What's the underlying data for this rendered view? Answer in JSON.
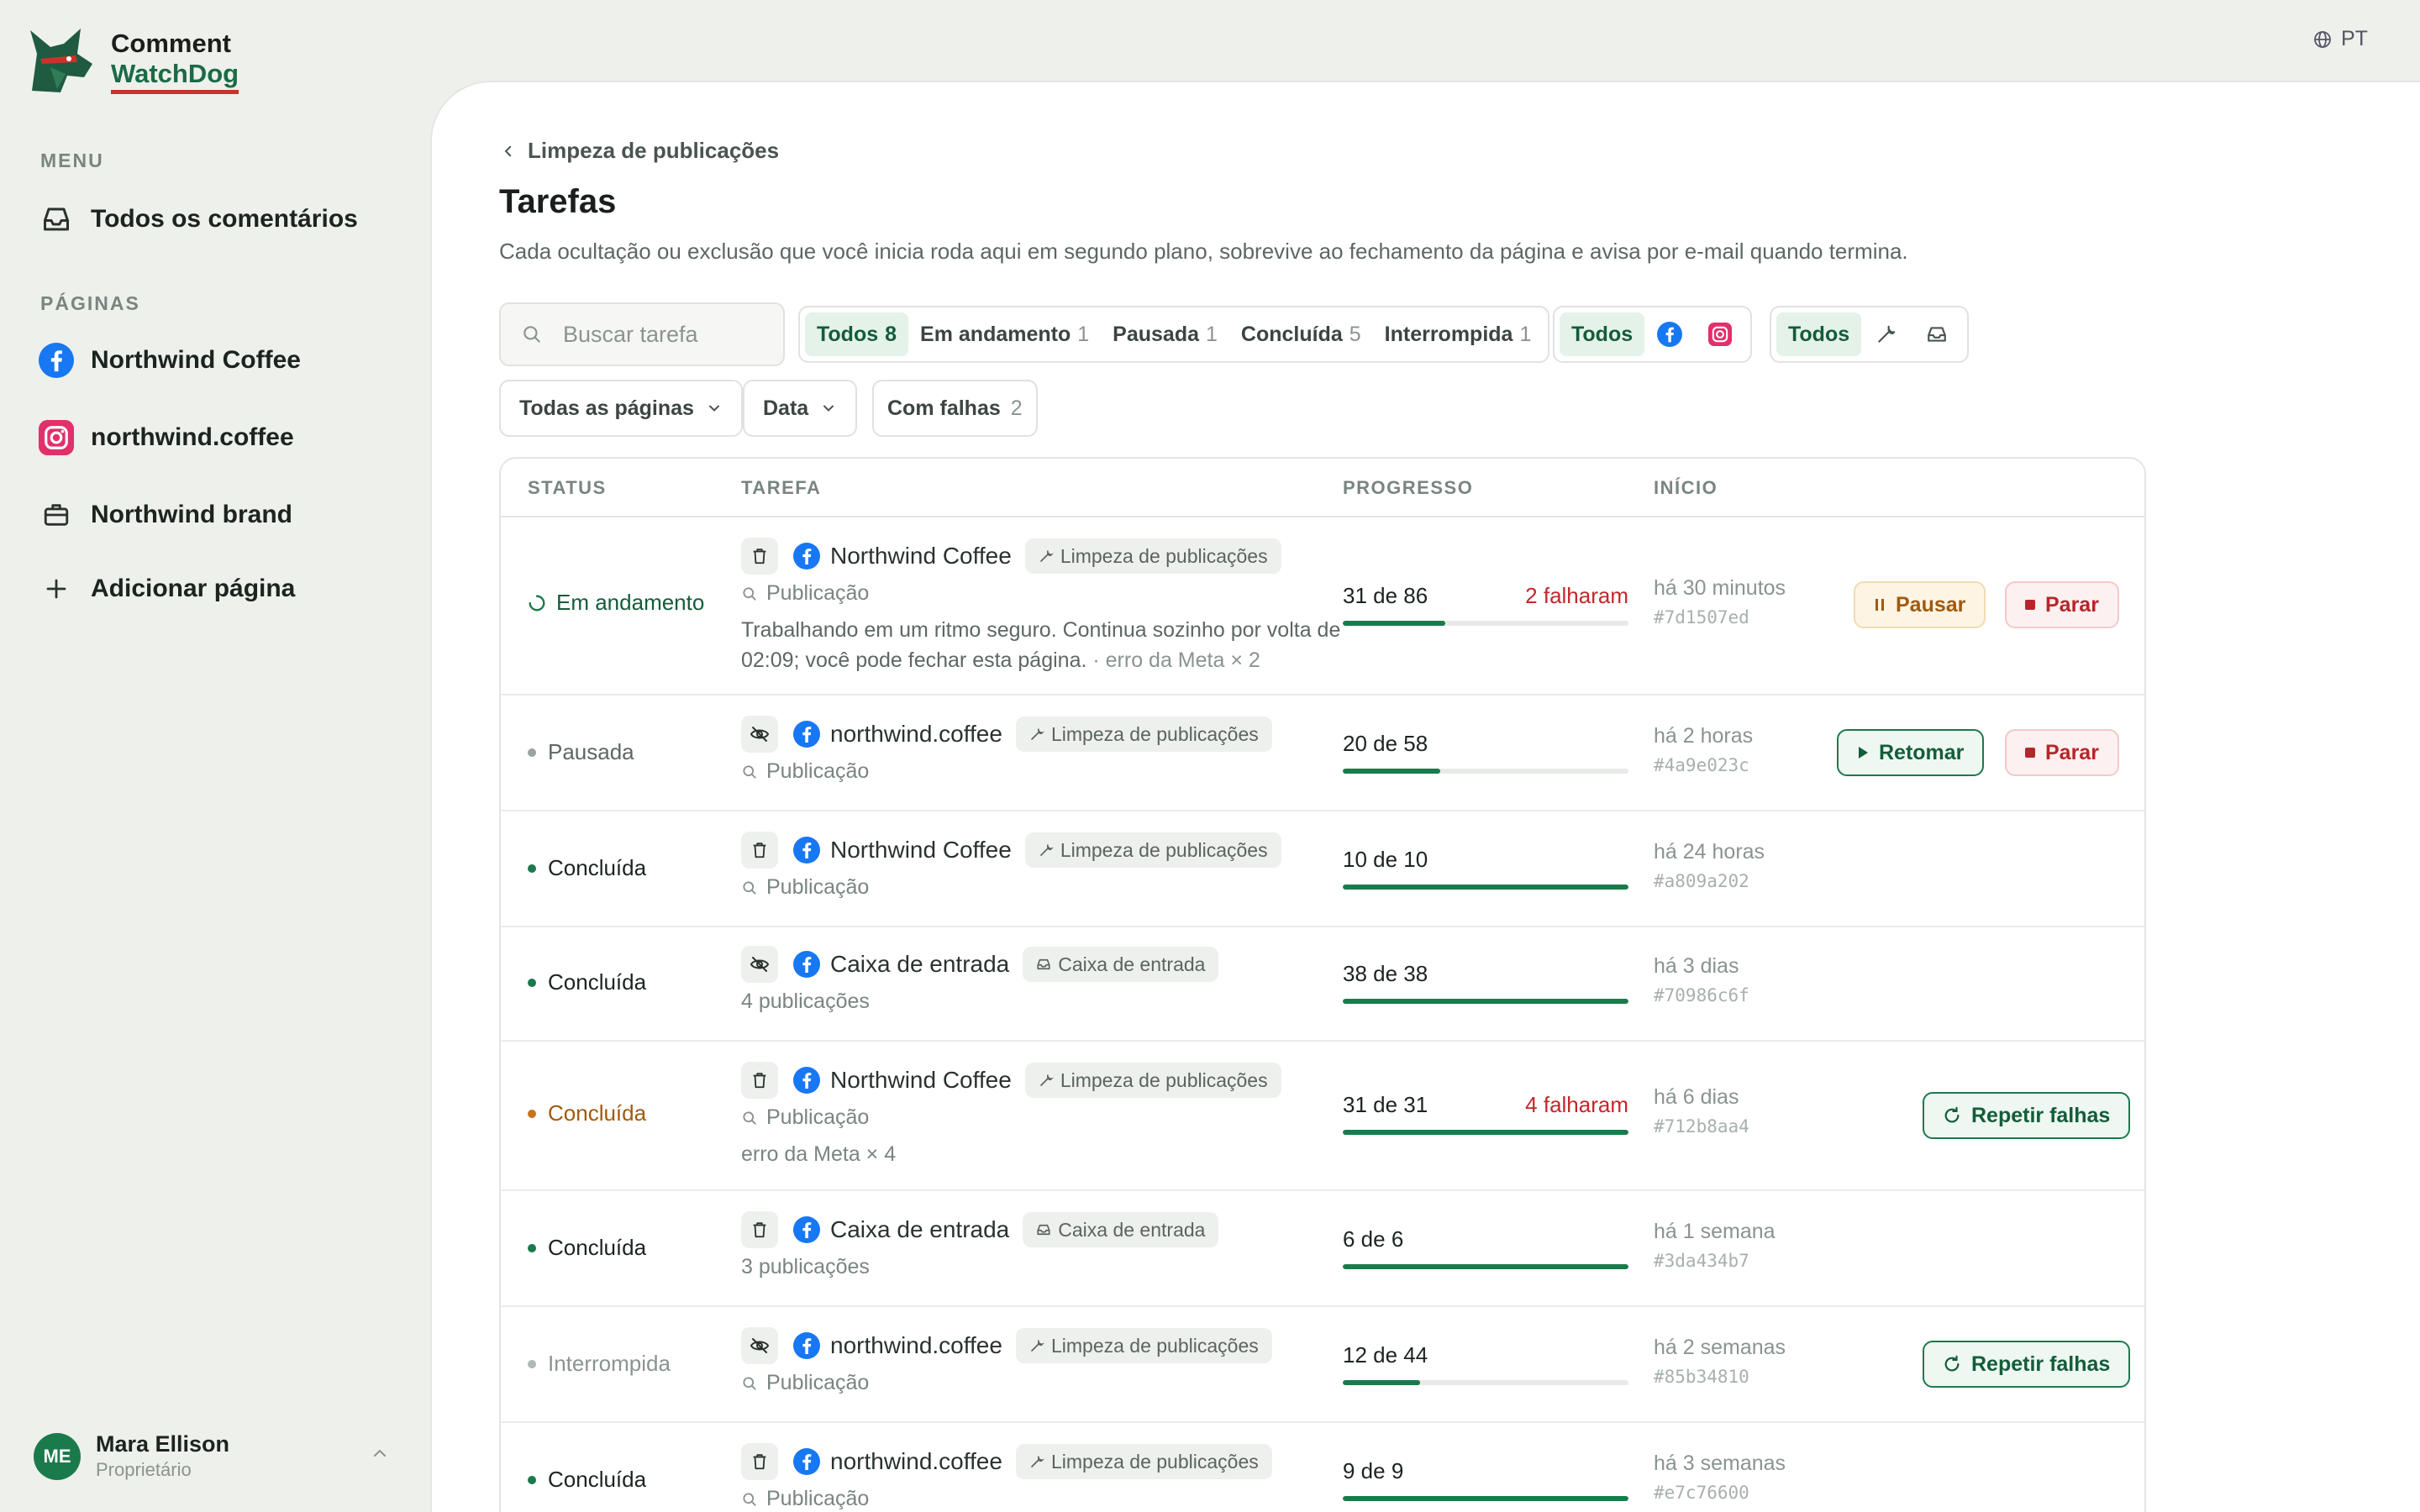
{
  "app": {
    "name_line1": "Comment",
    "name_line2": "WatchDog"
  },
  "lang": "PT",
  "sidebar": {
    "menu_label": "MENU",
    "menu_items": [
      {
        "label": "Todos os comentários",
        "icon": "inbox-icon"
      }
    ],
    "pages_label": "PÁGINAS",
    "pages": [
      {
        "label": "Northwind Coffee",
        "icon": "facebook-icon"
      },
      {
        "label": "northwind.coffee",
        "icon": "instagram-icon"
      },
      {
        "label": "Northwind brand",
        "icon": "briefcase-icon"
      },
      {
        "label": "Adicionar página",
        "icon": "plus-icon"
      }
    ],
    "user": {
      "initials": "ME",
      "name": "Mara Ellison",
      "role": "Proprietário"
    }
  },
  "page": {
    "breadcrumb": "Limpeza de publicações",
    "title": "Tarefas",
    "subtitle": "Cada ocultação ou exclusão que você inicia roda aqui em segundo plano, sobrevive ao fechamento da página e avisa por e-mail quando termina."
  },
  "filters": {
    "search_placeholder": "Buscar tarefa",
    "status": [
      {
        "label": "Todos",
        "count": "8",
        "active": true
      },
      {
        "label": "Em andamento",
        "count": "1"
      },
      {
        "label": "Pausada",
        "count": "1"
      },
      {
        "label": "Concluída",
        "count": "5"
      },
      {
        "label": "Interrompida",
        "count": "1"
      }
    ],
    "platform_all": "Todos",
    "type_all": "Todos",
    "pages_dropdown": "Todas as páginas",
    "date_dropdown": "Data",
    "failed_label": "Com falhas",
    "failed_count": "2"
  },
  "table": {
    "headers": {
      "status": "STATUS",
      "task": "TAREFA",
      "progress": "PROGRESSO",
      "start": "INÍCIO"
    },
    "rows": [
      {
        "status": "Em andamento",
        "page": "Northwind Coffee",
        "type": "Limpeza de publicações",
        "target": "Publicação",
        "note": "Trabalhando em um ritmo seguro. Continua sozinho por volta de 02:09; você pode fechar esta página.",
        "note_extra": "· erro da Meta × 2",
        "progress": "31 de 86",
        "fraction": 0.36,
        "failed": "2 falharam",
        "time": "há 30 minutos",
        "id": "#7d1507ed",
        "btn1": "Pausar",
        "btn2": "Parar"
      },
      {
        "status": "Pausada",
        "page": "northwind.coffee",
        "type": "Limpeza de publicações",
        "target": "Publicação",
        "progress": "20 de 58",
        "fraction": 0.34,
        "time": "há 2 horas",
        "id": "#4a9e023c",
        "btn1": "Retomar",
        "btn2": "Parar"
      },
      {
        "status": "Concluída",
        "page": "Northwind Coffee",
        "type": "Limpeza de publicações",
        "target": "Publicação",
        "progress": "10 de 10",
        "fraction": 1,
        "time": "há 24 horas",
        "id": "#a809a202"
      },
      {
        "status": "Concluída",
        "page": "Caixa de entrada",
        "type": "Caixa de entrada",
        "target": "4 publicações",
        "progress": "38 de 38",
        "fraction": 1,
        "time": "há 3 dias",
        "id": "#70986c6f"
      },
      {
        "status": "Concluída",
        "page": "Northwind Coffee",
        "type": "Limpeza de publicações",
        "target": "Publicação",
        "note": "erro da Meta × 4",
        "progress": "31 de 31",
        "fraction": 1,
        "failed": "4 falharam",
        "time": "há 6 dias",
        "id": "#712b8aa4",
        "btn1": "Repetir falhas"
      },
      {
        "status": "Concluída",
        "page": "Caixa de entrada",
        "type": "Caixa de entrada",
        "target": "3 publicações",
        "progress": "6 de 6",
        "fraction": 1,
        "time": "há 1 semana",
        "id": "#3da434b7"
      },
      {
        "status": "Interrompida",
        "page": "northwind.coffee",
        "type": "Limpeza de publicações",
        "target": "Publicação",
        "progress": "12 de 44",
        "fraction": 0.27,
        "time": "há 2 semanas",
        "id": "#85b34810",
        "btn1": "Repetir falhas"
      },
      {
        "status": "Concluída",
        "page": "northwind.coffee",
        "type": "Limpeza de publicações",
        "target": "Publicação",
        "progress": "9 de 9",
        "fraction": 1,
        "time": "há 3 semanas",
        "id": "#e7c76600"
      }
    ]
  },
  "colors": {
    "accent": "#1b7a4c",
    "danger": "#c4262b",
    "warning": "#a05a0f",
    "facebook": "#1877f2",
    "instagram": "#e1306c"
  }
}
